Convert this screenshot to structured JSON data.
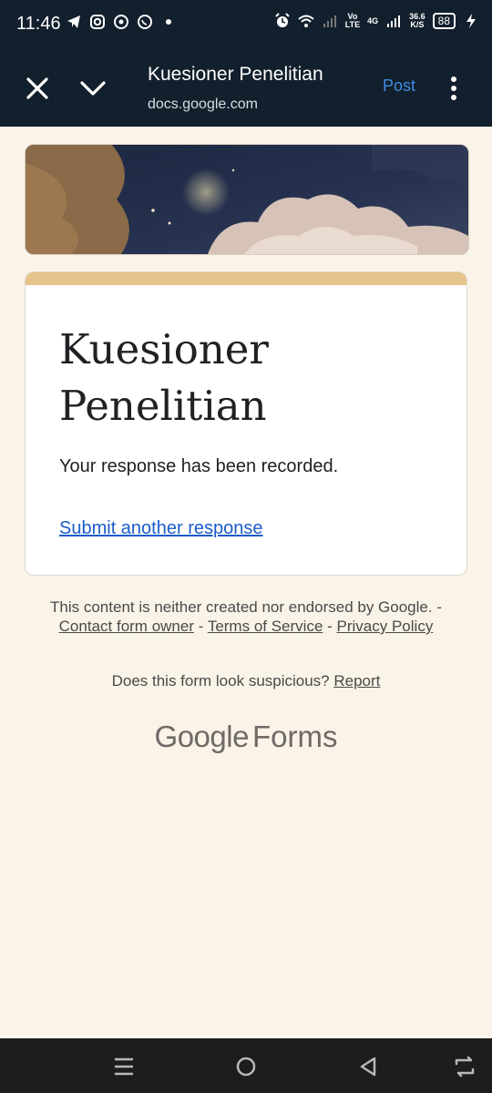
{
  "status_bar": {
    "time": "11:46",
    "net_vo": "Vo",
    "net_lte": "LTE",
    "net_4g": "4G",
    "speed_value": "36.6",
    "speed_unit": "K/S",
    "battery": "88"
  },
  "header": {
    "title": "Kuesioner Penelitian",
    "url": "docs.google.com",
    "post_label": "Post"
  },
  "form": {
    "title": "Kuesioner Penelitian",
    "confirmation": "Your response has been recorded.",
    "submit_another": "Submit another response"
  },
  "footer": {
    "disclaimer_text": "This content is neither created nor endorsed by Google. - ",
    "contact_owner": "Contact form owner",
    "sep1": " - ",
    "terms": "Terms of Service",
    "sep2": " - ",
    "privacy": "Privacy Policy",
    "suspicious_text": "Does this form look suspicious? ",
    "report": "Report",
    "brand_google": "Google",
    "brand_forms": "Forms"
  },
  "colors": {
    "header_bg": "#121f2c",
    "accent": "#e4c48a",
    "link": "#1a5cc8",
    "page_bg": "#faf3e8"
  },
  "icons": {
    "status_left": [
      "telegram-icon",
      "instagram-icon",
      "chat-icon",
      "whatsapp-icon",
      "dot-icon"
    ],
    "status_right": [
      "alarm-icon",
      "wifi-icon",
      "signal-icon",
      "battery-icon",
      "charging-icon"
    ],
    "nav": [
      "menu-icon",
      "home-icon",
      "back-icon",
      "rotate-icon"
    ]
  }
}
